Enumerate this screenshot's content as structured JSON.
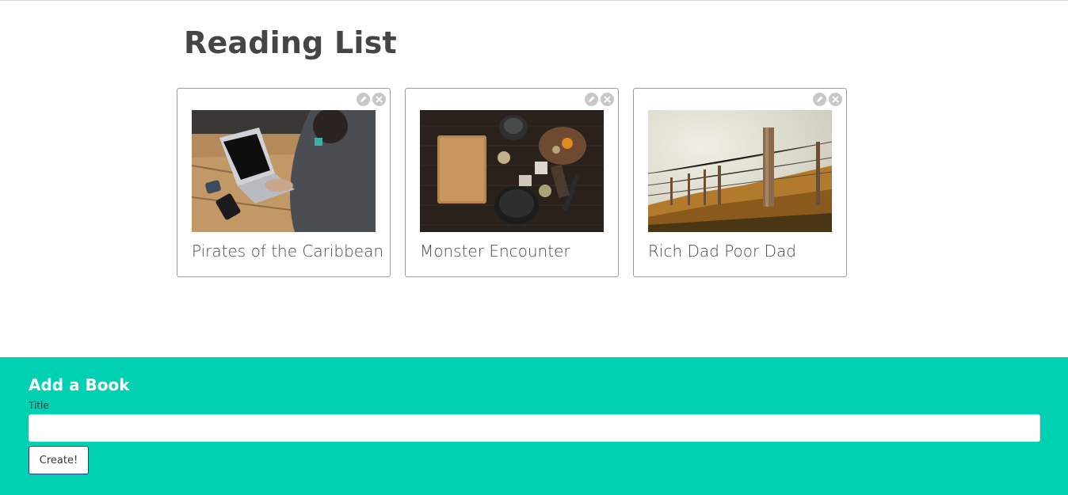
{
  "page": {
    "title": "Reading List"
  },
  "books": [
    {
      "title": "Pirates of the Caribbean",
      "image": "laptop-photo"
    },
    {
      "title": "Monster Encounter",
      "image": "kitchen-table-photo"
    },
    {
      "title": "Rich Dad Poor Dad",
      "image": "fence-field-photo"
    }
  ],
  "card_actions": {
    "edit_icon": "pencil-icon",
    "delete_icon": "close-icon"
  },
  "add_form": {
    "heading": "Add a Book",
    "title_label": "Title",
    "title_value": "",
    "title_placeholder": "",
    "create_label": "Create!"
  },
  "colors": {
    "accent": "#00d1b2",
    "heading": "#454545",
    "card_border": "#9e9e9e",
    "icon_bg": "#c8c8c8"
  }
}
